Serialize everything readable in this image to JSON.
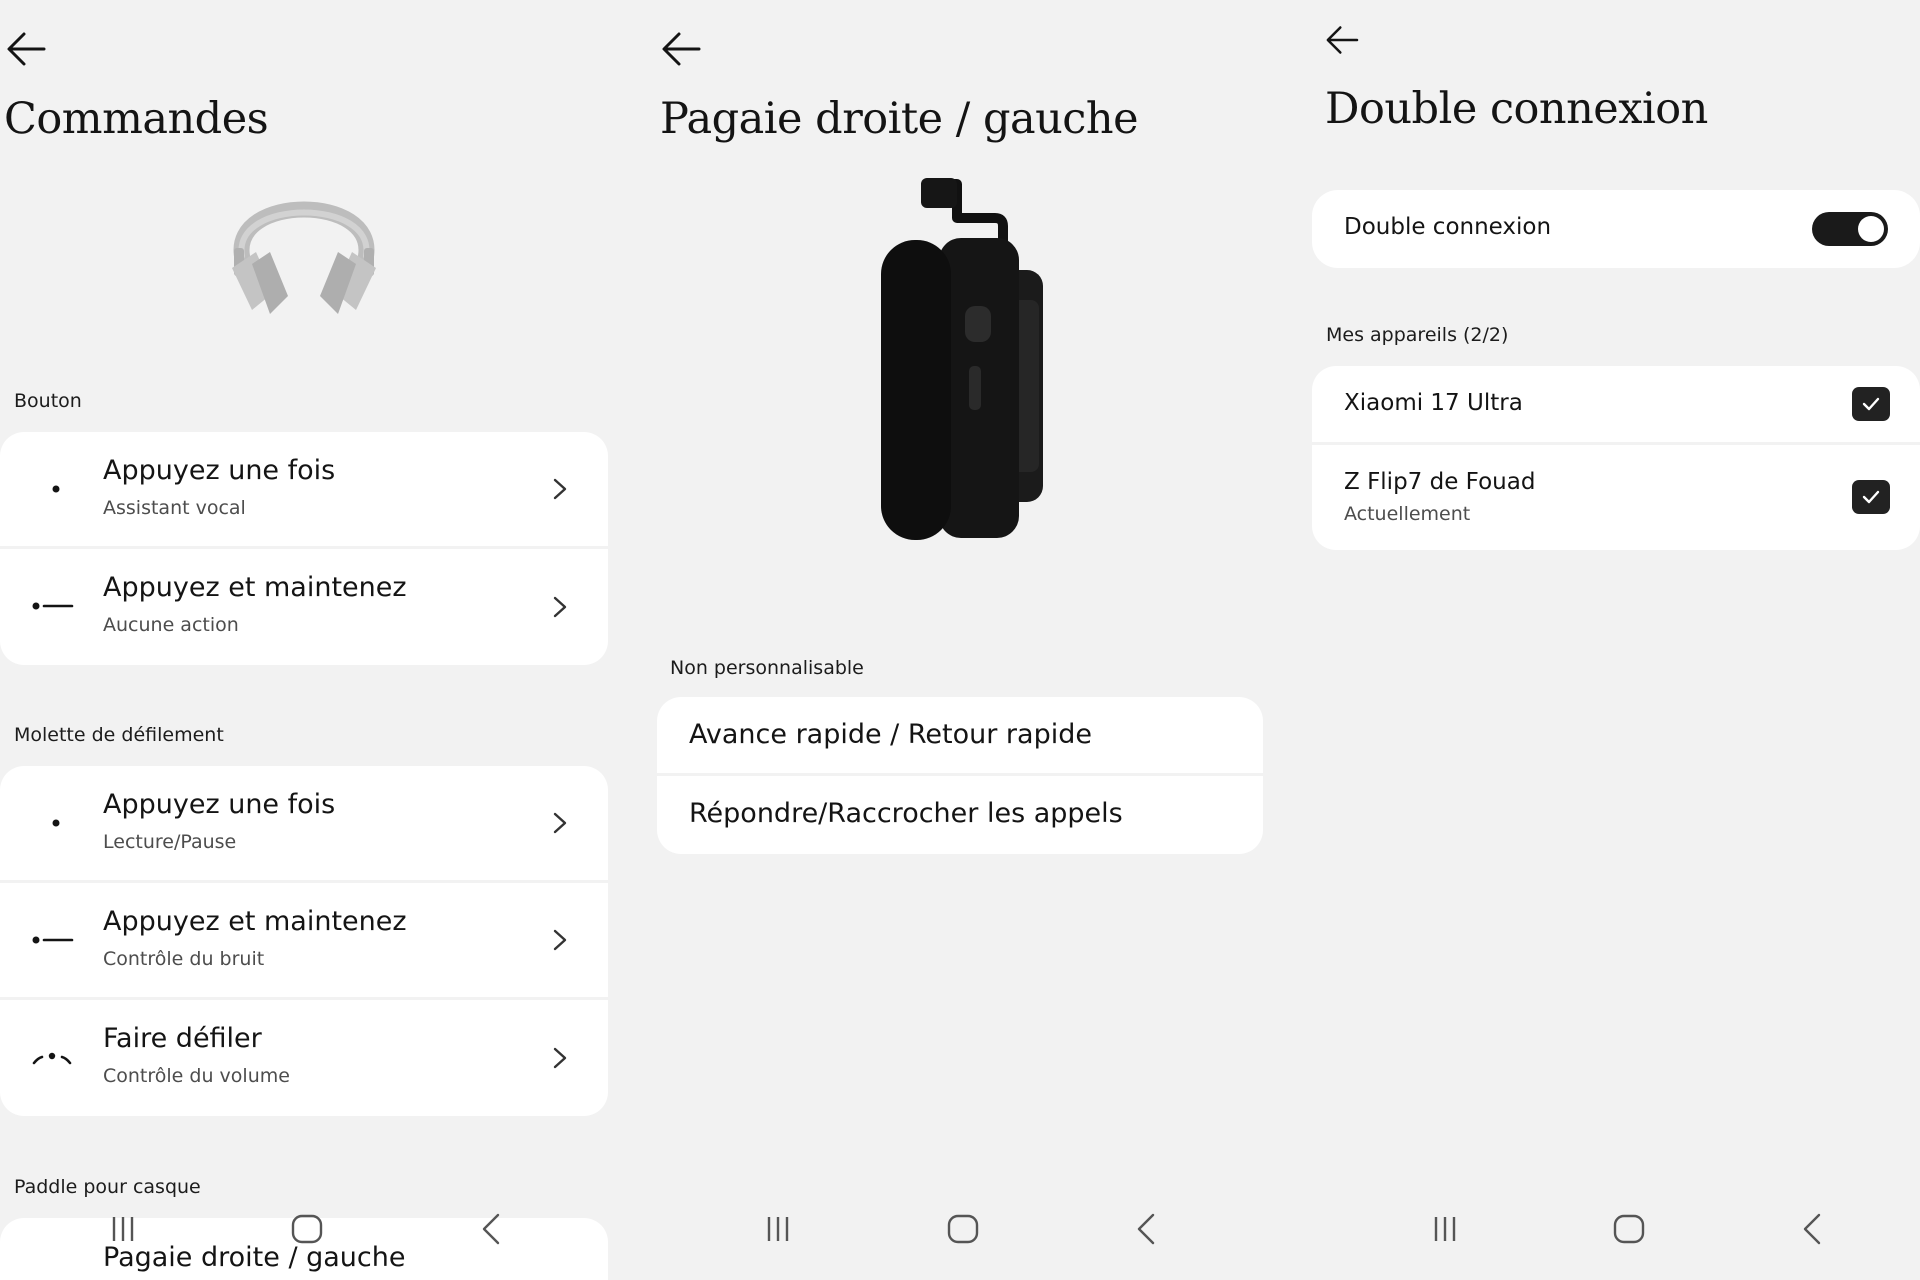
{
  "colors": {
    "background": "#f2f2f2",
    "card": "#ffffff",
    "text": "#141414",
    "secondary_text": "#4d4d4d",
    "accent": "#1a1a1a"
  },
  "screen1": {
    "title": "Commandes",
    "back_icon": "arrow-left-icon",
    "sections": [
      {
        "label": "Bouton",
        "items": [
          {
            "icon": "single-tap-gesture-icon",
            "title": "Appuyez une fois",
            "subtitle": "Assistant vocal"
          },
          {
            "icon": "press-and-hold-gesture-icon",
            "title": "Appuyez et maintenez",
            "subtitle": "Aucune action"
          }
        ]
      },
      {
        "label": "Molette de défilement",
        "items": [
          {
            "icon": "single-tap-gesture-icon",
            "title": "Appuyez une fois",
            "subtitle": "Lecture/Pause"
          },
          {
            "icon": "press-and-hold-gesture-icon",
            "title": "Appuyez et maintenez",
            "subtitle": "Contrôle du bruit"
          },
          {
            "icon": "scroll-gesture-icon",
            "title": "Faire défiler",
            "subtitle": "Contrôle du volume"
          }
        ]
      },
      {
        "label": "Paddle pour casque",
        "items": [
          {
            "title": "Pagaie droite / gauche"
          }
        ]
      }
    ]
  },
  "screen2": {
    "title": "Pagaie droite / gauche",
    "back_icon": "arrow-left-icon",
    "section_label": "Non personnalisable",
    "items": [
      {
        "title": "Avance rapide / Retour rapide"
      },
      {
        "title": "Répondre/Raccrocher les appels"
      }
    ]
  },
  "screen3": {
    "title": "Double connexion",
    "back_icon": "arrow-left-icon",
    "toggle": {
      "label": "Double connexion",
      "on": true
    },
    "devices_label": "Mes appareils (2/2)",
    "devices": [
      {
        "name": "Xiaomi 17 Ultra",
        "status": "",
        "checked": true
      },
      {
        "name": "Z Flip7 de Fouad",
        "status": "Actuellement",
        "checked": true
      }
    ]
  },
  "navbar": {
    "icons": [
      "recent-apps-icon",
      "home-icon",
      "back-nav-icon"
    ]
  }
}
